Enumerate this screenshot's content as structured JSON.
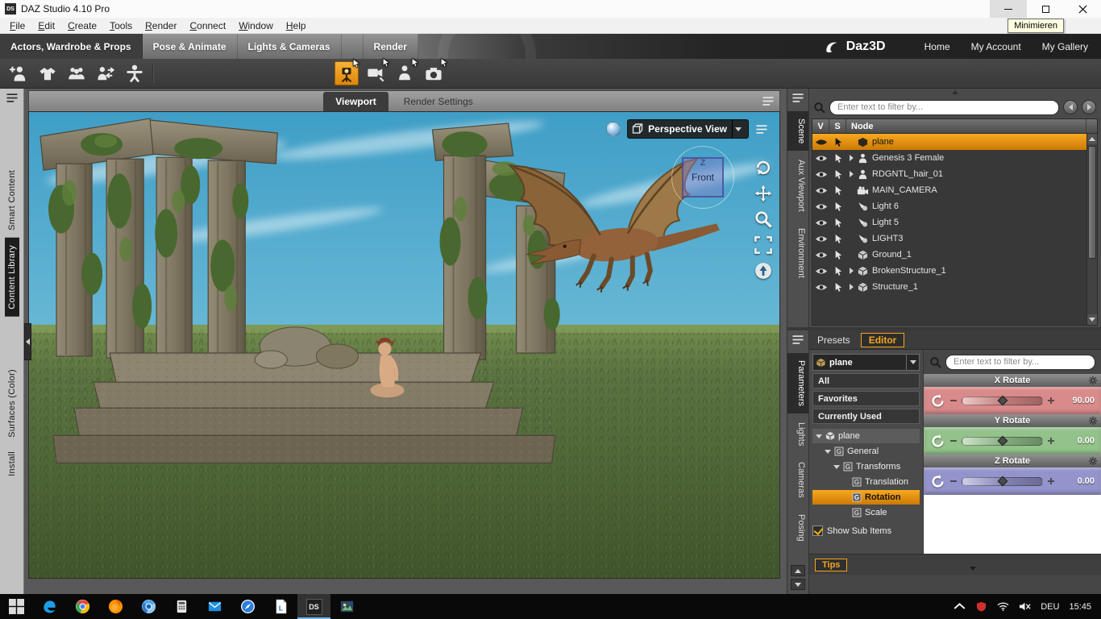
{
  "titlebar": {
    "app_icon": "DS",
    "title": "DAZ Studio 4.10 Pro",
    "tooltip": "Minimieren"
  },
  "menubar": {
    "items": [
      "File",
      "Edit",
      "Create",
      "Tools",
      "Render",
      "Connect",
      "Window",
      "Help"
    ]
  },
  "activity_bar": {
    "tabs": [
      {
        "label": "Actors, Wardrobe & Props",
        "active": true
      },
      {
        "label": "Pose & Animate",
        "active": false
      },
      {
        "label": "Lights & Cameras",
        "active": false
      },
      {
        "label": "Render",
        "active": false,
        "offset": true
      }
    ],
    "brand": "Daz3D",
    "links": [
      "Home",
      "My Account",
      "My Gallery"
    ]
  },
  "toolbar": {
    "left_icons": [
      "add-figure",
      "wardrobe",
      "people-group",
      "transfer-figure",
      "pose-tool"
    ],
    "center_icons": [
      {
        "name": "render-camera",
        "active": true
      },
      {
        "name": "spot-render",
        "active": false
      },
      {
        "name": "render-figure",
        "active": false
      },
      {
        "name": "camera-tool",
        "active": false
      }
    ]
  },
  "left_dock": {
    "tabs": [
      {
        "label": "Smart Content",
        "active": false
      },
      {
        "label": "Content Library",
        "active": true
      },
      {
        "label": "Surfaces (Color)",
        "active": false,
        "gap_before": true
      },
      {
        "label": "Install",
        "active": false
      }
    ]
  },
  "viewport": {
    "tabs": [
      {
        "label": "Viewport",
        "active": true
      },
      {
        "label": "Render Settings",
        "active": false
      }
    ],
    "view_selector": {
      "label": "Perspective View"
    },
    "axis_cube": {
      "label": "Front",
      "axis": "Z"
    },
    "tools": [
      "orbit",
      "pan",
      "zoom",
      "frame",
      "aim"
    ]
  },
  "scene_panel": {
    "filter_placeholder": "Enter text to filter by...",
    "columns": [
      "V",
      "S",
      "Node"
    ],
    "nodes": [
      {
        "name": "plane",
        "icon": "prop",
        "expandable": false,
        "selected": true
      },
      {
        "name": "Genesis 3 Female",
        "icon": "figure",
        "expandable": true,
        "selected": false
      },
      {
        "name": "RDGNTL_hair_01",
        "icon": "figure",
        "expandable": true,
        "selected": false
      },
      {
        "name": "MAIN_CAMERA",
        "icon": "camera",
        "expandable": false,
        "selected": false
      },
      {
        "name": "Light 6",
        "icon": "light",
        "expandable": false,
        "selected": false
      },
      {
        "name": "Light 5",
        "icon": "light",
        "expandable": false,
        "selected": false
      },
      {
        "name": "LIGHT3",
        "icon": "light",
        "expandable": false,
        "selected": false
      },
      {
        "name": "Ground_1",
        "icon": "prop",
        "expandable": false,
        "selected": false
      },
      {
        "name": "BrokenStructure_1",
        "icon": "prop",
        "expandable": true,
        "selected": false
      },
      {
        "name": "Structure_1",
        "icon": "prop",
        "expandable": true,
        "selected": false
      }
    ]
  },
  "right_dock_top": {
    "tabs": [
      {
        "label": "Scene",
        "active": true
      },
      {
        "label": "Aux Viewport",
        "active": false
      },
      {
        "label": "Environment",
        "active": false
      }
    ]
  },
  "right_dock_bottom": {
    "tabs": [
      {
        "label": "Parameters",
        "active": true
      },
      {
        "label": "Lights",
        "active": false
      },
      {
        "label": "Cameras",
        "active": false
      },
      {
        "label": "Posing",
        "active": false
      }
    ]
  },
  "editor_panel": {
    "tabs": [
      {
        "label": "Presets",
        "active": false
      },
      {
        "label": "Editor",
        "active": true
      }
    ],
    "node_selector": "plane",
    "filter_placeholder": "Enter text to filter by...",
    "quick_filters": [
      "All",
      "Favorites",
      "Currently Used"
    ],
    "tree": [
      {
        "label": "plane",
        "depth": 0,
        "icon": "plane",
        "expander": true,
        "selected": false
      },
      {
        "label": "General",
        "depth": 1,
        "icon": "group",
        "expander": true,
        "selected": false
      },
      {
        "label": "Transforms",
        "depth": 2,
        "icon": "group",
        "expander": true,
        "selected": false
      },
      {
        "label": "Translation",
        "depth": 3,
        "icon": "group",
        "expander": false,
        "selected": false
      },
      {
        "label": "Rotation",
        "depth": 3,
        "icon": "group",
        "expander": false,
        "selected": true
      },
      {
        "label": "Scale",
        "depth": 3,
        "icon": "group",
        "expander": false,
        "selected": false
      }
    ],
    "show_sub_items_label": "Show Sub Items",
    "show_sub_items_checked": true,
    "sliders": [
      {
        "label": "X Rotate",
        "value": "90.00",
        "color": "#d98a8a"
      },
      {
        "label": "Y Rotate",
        "value": "0.00",
        "color": "#93c28b"
      },
      {
        "label": "Z Rotate",
        "value": "0.00",
        "color": "#9494cc"
      }
    ],
    "tips_label": "Tips"
  },
  "taskbar": {
    "apps": [
      {
        "name": "start"
      },
      {
        "name": "edge"
      },
      {
        "name": "chrome"
      },
      {
        "name": "firefox"
      },
      {
        "name": "chromium"
      },
      {
        "name": "calculator"
      },
      {
        "name": "mail"
      },
      {
        "name": "compass"
      },
      {
        "name": "libreoffice"
      },
      {
        "name": "daz-studio",
        "label": "DS",
        "active": true
      },
      {
        "name": "photos"
      }
    ],
    "tray": {
      "icons": [
        "hidden-icons",
        "security",
        "network",
        "volume-muted"
      ],
      "lang": "DEU",
      "time": "15:45"
    }
  },
  "colors": {
    "accent_orange": "#f6a41c",
    "selection_orange": "#e8920f"
  }
}
